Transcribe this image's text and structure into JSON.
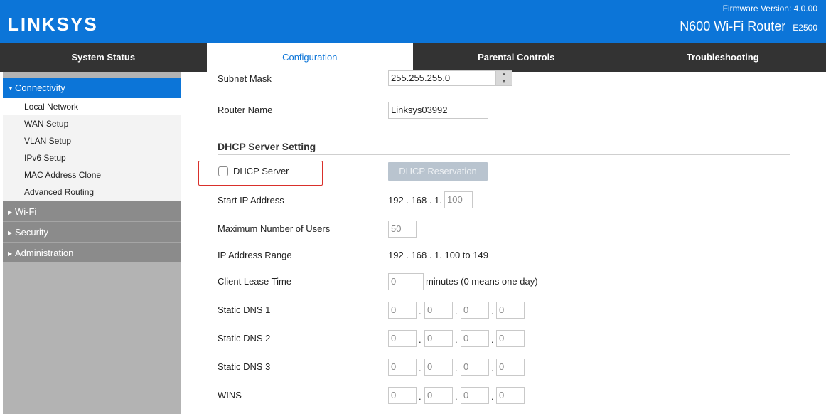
{
  "header": {
    "logo": "LINKSYS",
    "firmware": "Firmware Version: 4.0.00",
    "model": "N600 Wi-Fi Router",
    "model_code": "E2500"
  },
  "tabs": [
    {
      "label": "System Status",
      "active": false
    },
    {
      "label": "Configuration",
      "active": true
    },
    {
      "label": "Parental Controls",
      "active": false
    },
    {
      "label": "Troubleshooting",
      "active": false
    }
  ],
  "sidebar": {
    "open_section": "Connectivity",
    "items": [
      "Local Network",
      "WAN Setup",
      "VLAN Setup",
      "IPv6 Setup",
      "MAC Address Clone",
      "Advanced Routing"
    ],
    "closed_sections": [
      "Wi-Fi",
      "Security",
      "Administration"
    ]
  },
  "form": {
    "subnet_mask_label": "Subnet Mask",
    "subnet_mask_value": "255.255.255.0",
    "router_name_label": "Router Name",
    "router_name_value": "Linksys03992",
    "dhcp_section_title": "DHCP Server Setting",
    "dhcp_server_label": "DHCP Server",
    "dhcp_server_checked": false,
    "dhcp_reservation_button": "DHCP Reservation",
    "start_ip_label": "Start IP Address",
    "start_ip_prefix": "192 . 168 . 1.",
    "start_ip_last": "100",
    "max_users_label": "Maximum Number of  Users",
    "max_users_value": "50",
    "ip_range_label": "IP Address Range",
    "ip_range_value": "192 . 168 . 1. 100 to 149",
    "lease_label": "Client Lease Time",
    "lease_value": "0",
    "lease_suffix": "minutes (0 means one day)",
    "dns1_label": "Static DNS 1",
    "dns1": [
      "0",
      "0",
      "0",
      "0"
    ],
    "dns2_label": "Static DNS 2",
    "dns2": [
      "0",
      "0",
      "0",
      "0"
    ],
    "dns3_label": "Static DNS 3",
    "dns3": [
      "0",
      "0",
      "0",
      "0"
    ],
    "wins_label": "WINS",
    "wins": [
      "0",
      "0",
      "0",
      "0"
    ]
  },
  "colors": {
    "brand_blue": "#0c75d8",
    "nav_dark": "#333333",
    "highlight_red": "#d9302b"
  }
}
